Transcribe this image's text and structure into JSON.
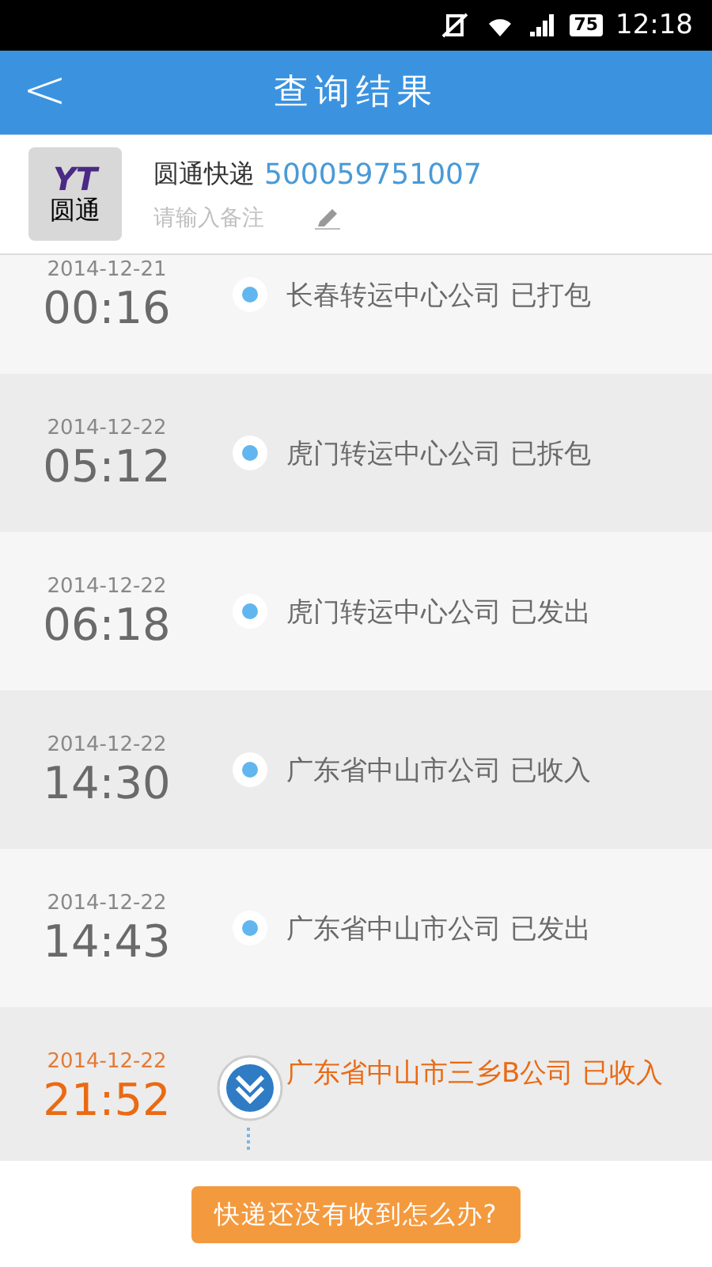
{
  "status_bar": {
    "battery": "75",
    "time": "12:18"
  },
  "header": {
    "back": "<",
    "title": "查询结果"
  },
  "package": {
    "logo_mark": "YT",
    "logo_text": "圆通",
    "courier": "圆通快递",
    "tracking_number": "500059751007",
    "note_placeholder": "请输入备注"
  },
  "events": [
    {
      "date": "2014-12-21",
      "time": "00:16",
      "text": "长春转运中心公司 已打包",
      "current": false
    },
    {
      "date": "2014-12-22",
      "time": "05:12",
      "text": "虎门转运中心公司 已拆包",
      "current": false
    },
    {
      "date": "2014-12-22",
      "time": "06:18",
      "text": "虎门转运中心公司 已发出",
      "current": false
    },
    {
      "date": "2014-12-22",
      "time": "14:30",
      "text": "广东省中山市公司 已收入",
      "current": false
    },
    {
      "date": "2014-12-22",
      "time": "14:43",
      "text": "广东省中山市公司 已发出",
      "current": false
    },
    {
      "date": "2014-12-22",
      "time": "21:52",
      "text": "广东省中山市三乡B公司 已收入",
      "current": true
    }
  ],
  "help_button": "快递还没有收到怎么办?"
}
